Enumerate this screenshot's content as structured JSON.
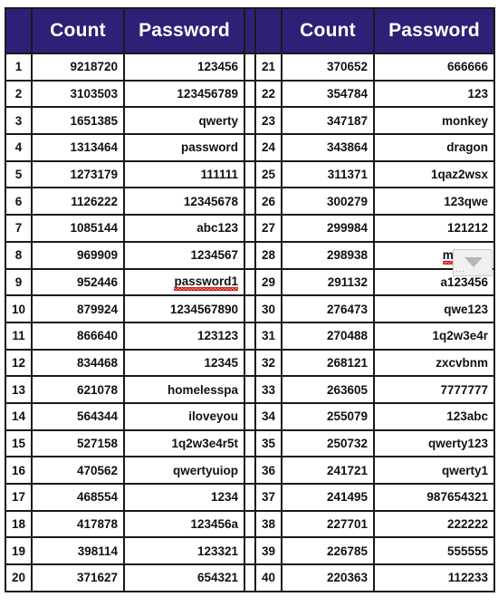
{
  "table": {
    "headers": {
      "rank": "",
      "count": "Count",
      "password": "Password"
    },
    "accent_color": "#2e2077",
    "border_color": "#1a1a1a",
    "spellcheck_color": "#d01e14",
    "left_rows": [
      {
        "rank": "1",
        "count": "9218720",
        "password": "123456",
        "spellcheck": false
      },
      {
        "rank": "2",
        "count": "3103503",
        "password": "123456789",
        "spellcheck": false
      },
      {
        "rank": "3",
        "count": "1651385",
        "password": "qwerty",
        "spellcheck": false
      },
      {
        "rank": "4",
        "count": "1313464",
        "password": "password",
        "spellcheck": false
      },
      {
        "rank": "5",
        "count": "1273179",
        "password": "111111",
        "spellcheck": false
      },
      {
        "rank": "6",
        "count": "1126222",
        "password": "12345678",
        "spellcheck": false
      },
      {
        "rank": "7",
        "count": "1085144",
        "password": "abc123",
        "spellcheck": false
      },
      {
        "rank": "8",
        "count": "969909",
        "password": "1234567",
        "spellcheck": false
      },
      {
        "rank": "9",
        "count": "952446",
        "password": "password1",
        "spellcheck": true
      },
      {
        "rank": "10",
        "count": "879924",
        "password": "1234567890",
        "spellcheck": false
      },
      {
        "rank": "11",
        "count": "866640",
        "password": "123123",
        "spellcheck": false
      },
      {
        "rank": "12",
        "count": "834468",
        "password": "12345",
        "spellcheck": false
      },
      {
        "rank": "13",
        "count": "621078",
        "password": "homelesspa",
        "spellcheck": false
      },
      {
        "rank": "14",
        "count": "564344",
        "password": "iloveyou",
        "spellcheck": false
      },
      {
        "rank": "15",
        "count": "527158",
        "password": "1q2w3e4r5t",
        "spellcheck": false
      },
      {
        "rank": "16",
        "count": "470562",
        "password": "qwertyuiop",
        "spellcheck": false
      },
      {
        "rank": "17",
        "count": "468554",
        "password": "1234",
        "spellcheck": false
      },
      {
        "rank": "18",
        "count": "417878",
        "password": "123456a",
        "spellcheck": false
      },
      {
        "rank": "19",
        "count": "398114",
        "password": "123321",
        "spellcheck": false
      },
      {
        "rank": "20",
        "count": "371627",
        "password": "654321",
        "spellcheck": false
      }
    ],
    "right_rows": [
      {
        "rank": "21",
        "count": "370652",
        "password": "666666",
        "spellcheck": false
      },
      {
        "rank": "22",
        "count": "354784",
        "password": "123",
        "spellcheck": false
      },
      {
        "rank": "23",
        "count": "347187",
        "password": "monkey",
        "spellcheck": false
      },
      {
        "rank": "24",
        "count": "343864",
        "password": "dragon",
        "spellcheck": false
      },
      {
        "rank": "25",
        "count": "311371",
        "password": "1qaz2wsx",
        "spellcheck": false
      },
      {
        "rank": "26",
        "count": "300279",
        "password": "123qwe",
        "spellcheck": false
      },
      {
        "rank": "27",
        "count": "299984",
        "password": "121212",
        "spellcheck": false
      },
      {
        "rank": "28",
        "count": "298938",
        "password": "myspac",
        "spellcheck": true
      },
      {
        "rank": "29",
        "count": "291132",
        "password": "a123456",
        "spellcheck": false
      },
      {
        "rank": "30",
        "count": "276473",
        "password": "qwe123",
        "spellcheck": false
      },
      {
        "rank": "31",
        "count": "270488",
        "password": "1q2w3e4r",
        "spellcheck": false
      },
      {
        "rank": "32",
        "count": "268121",
        "password": "zxcvbnm",
        "spellcheck": false
      },
      {
        "rank": "33",
        "count": "263605",
        "password": "7777777",
        "spellcheck": false
      },
      {
        "rank": "34",
        "count": "255079",
        "password": "123abc",
        "spellcheck": false
      },
      {
        "rank": "35",
        "count": "250732",
        "password": "qwerty123",
        "spellcheck": false
      },
      {
        "rank": "36",
        "count": "241721",
        "password": "qwerty1",
        "spellcheck": false
      },
      {
        "rank": "37",
        "count": "241495",
        "password": "987654321",
        "spellcheck": false
      },
      {
        "rank": "38",
        "count": "227701",
        "password": "222222",
        "spellcheck": false
      },
      {
        "rank": "39",
        "count": "226785",
        "password": "555555",
        "spellcheck": false
      },
      {
        "rank": "40",
        "count": "220363",
        "password": "112233",
        "spellcheck": false
      }
    ]
  },
  "overlay": {
    "autocomplete_icon": "dropdown-arrow-icon",
    "ellipsis": "..."
  }
}
